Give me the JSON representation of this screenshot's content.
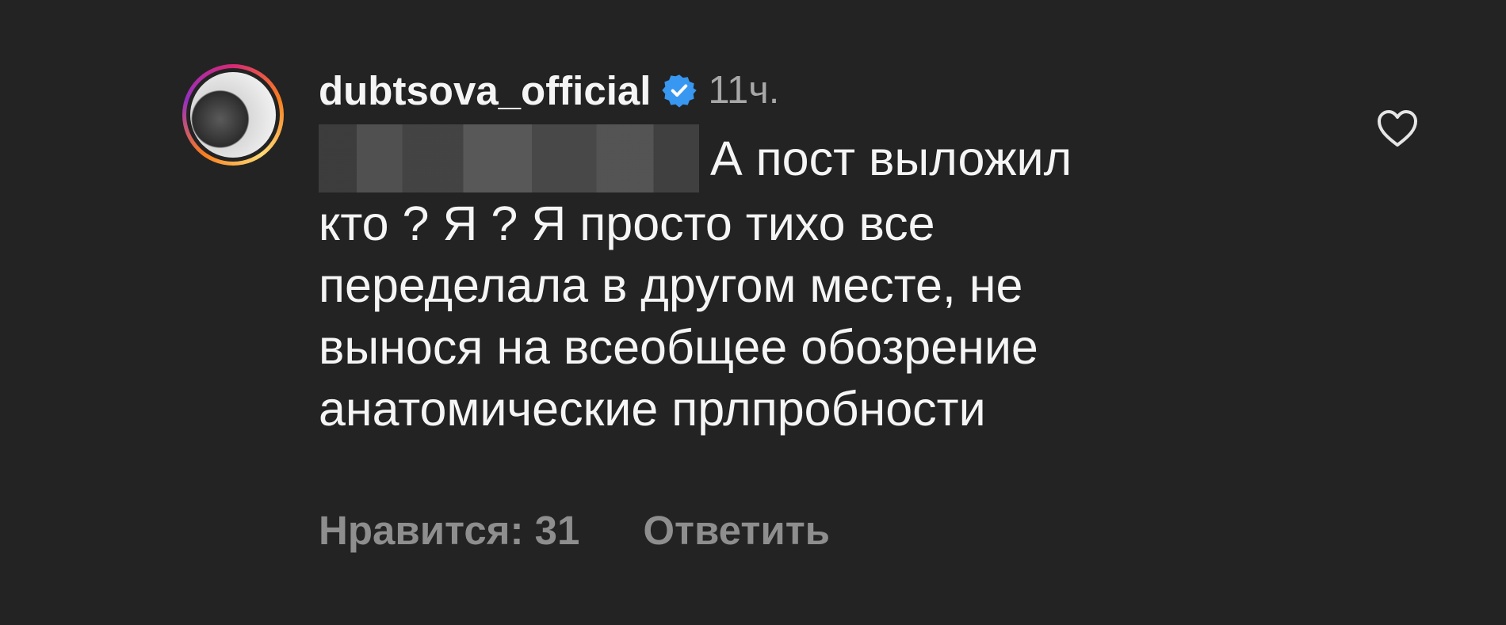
{
  "comment": {
    "username": "dubtsova_official",
    "verified": true,
    "time": "11ч.",
    "redacted_mention": true,
    "lines": [
      "А пост выложил",
      "кто ? Я ? Я просто тихо все",
      "переделала в другом месте, не",
      "вынося на всеобщее обозрение",
      "анатомические прлпробности"
    ]
  },
  "actions": {
    "likes_label": "Нравится: 31",
    "reply_label": "Ответить"
  },
  "icons": {
    "verified": "verified-badge-icon",
    "like": "heart-icon"
  },
  "colors": {
    "background": "#232323",
    "text": "#f5f5f5",
    "secondary": "#8e8e8e",
    "verified": "#3897f0"
  }
}
